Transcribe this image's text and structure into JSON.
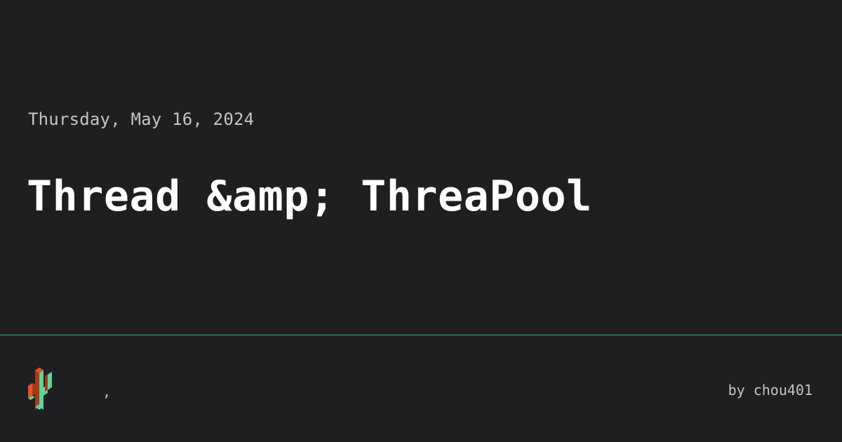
{
  "post": {
    "date": "Thursday, May 16, 2024",
    "title": "Thread &amp; ThreaPool"
  },
  "footer": {
    "logo_icon": "cactus-logo-icon",
    "site_name": ",",
    "author": "by chou401"
  },
  "colors": {
    "background": "#1e1f21",
    "divider": "#3fa57a",
    "date_text": "#c3c4c6",
    "title_text": "#ffffff",
    "logo_green": "#5fd39a",
    "logo_orange": "#e2552a",
    "logo_dark_orange": "#a8391a"
  }
}
